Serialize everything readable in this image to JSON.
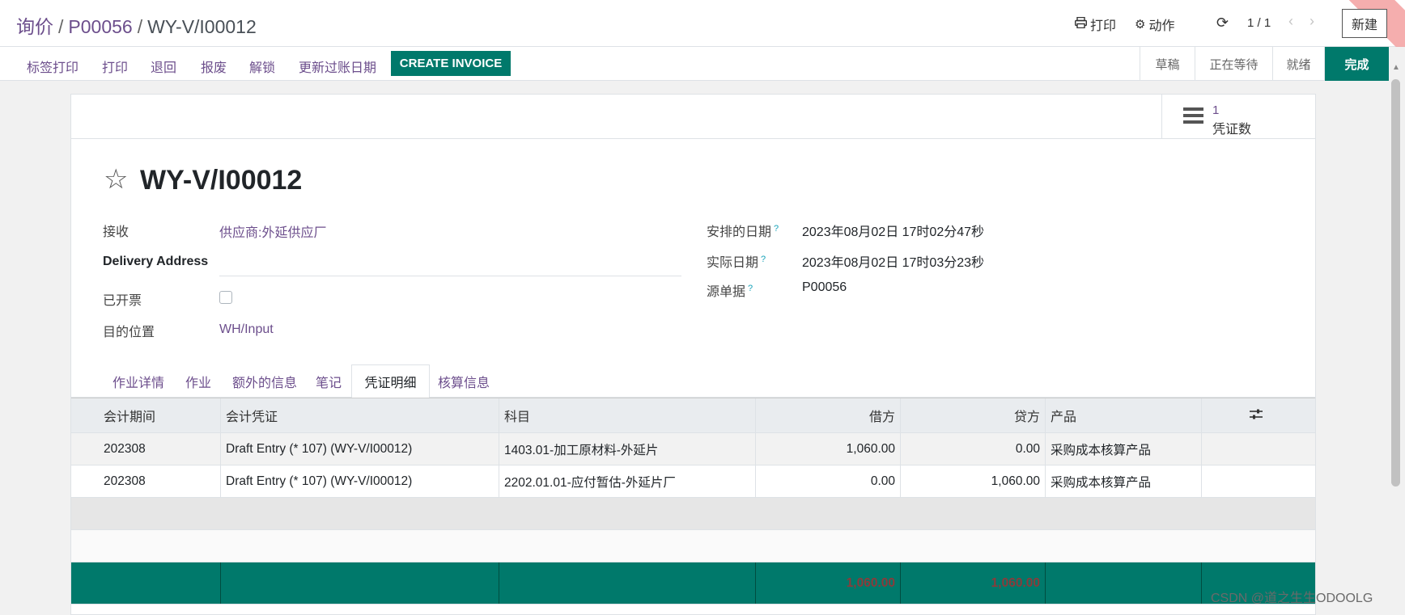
{
  "breadcrumb": {
    "root": "询价",
    "middle": "P00056",
    "current": "WY-V/I00012",
    "separator": "/"
  },
  "top_actions": {
    "print": "打印",
    "action": "动作",
    "pager": "1 / 1",
    "new_button": "新建"
  },
  "action_buttons": [
    "标签打印",
    "打印",
    "退回",
    "报废",
    "解锁",
    "更新过账日期"
  ],
  "create_invoice": "CREATE INVOICE",
  "status_steps": [
    {
      "label": "草稿",
      "active": false
    },
    {
      "label": "正在等待",
      "active": false
    },
    {
      "label": "就绪",
      "active": false
    },
    {
      "label": "完成",
      "active": true
    }
  ],
  "stat_button": {
    "value": "1",
    "label": "凭证数"
  },
  "record": {
    "title": "WY-V/I00012",
    "left_fields": [
      {
        "label": "接收",
        "value": "供应商:外延供应厂"
      },
      {
        "label": "Delivery Address",
        "value": ""
      },
      {
        "label": "已开票",
        "value": ""
      },
      {
        "label": "目的位置",
        "value": "WH/Input"
      }
    ],
    "right_fields": [
      {
        "label": "安排的日期",
        "help": "?",
        "value": "2023年08月02日 17时02分47秒"
      },
      {
        "label": "实际日期",
        "help": "?",
        "value": "2023年08月02日 17时03分23秒"
      },
      {
        "label": "源单据",
        "help": "?",
        "value": "P00056"
      }
    ]
  },
  "tabs": [
    {
      "label": "作业详情",
      "active": false
    },
    {
      "label": "作业",
      "active": false
    },
    {
      "label": "额外的信息",
      "active": false
    },
    {
      "label": "笔记",
      "active": false
    },
    {
      "label": "凭证明细",
      "active": true
    },
    {
      "label": "核算信息",
      "active": false
    }
  ],
  "table": {
    "columns": [
      "会计期间",
      "会计凭证",
      "科目",
      "借方",
      "贷方",
      "产品"
    ],
    "rows": [
      [
        "202308",
        "Draft Entry (* 107) (WY-V/I00012)",
        "1403.01-加工原材料-外延片",
        "1,060.00",
        "0.00",
        "采购成本核算产品"
      ],
      [
        "202308",
        "Draft Entry (* 107) (WY-V/I00012)",
        "2202.01.01-应付暂估-外延片厂",
        "0.00",
        "1,060.00",
        "采购成本核算产品"
      ]
    ],
    "totals": {
      "debit": "1,060.00",
      "credit": "1,060.00"
    }
  },
  "watermark": "CSDN @道之生生ODOOLG",
  "colors": {
    "primary": "#00796b",
    "link": "#6c4e8c"
  }
}
